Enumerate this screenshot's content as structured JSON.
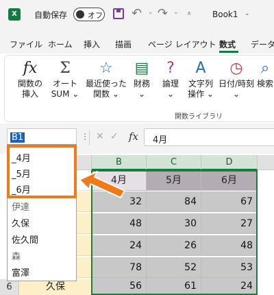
{
  "titlebar": {
    "app_icon": "X",
    "autosave_label": "自動保存",
    "autosave_state": "オフ",
    "document_title": "Book1",
    "icons": [
      "excel-icon",
      "save-icon",
      "undo-icon",
      "redo-icon",
      "customize-qat-icon"
    ]
  },
  "tabs": [
    "ファイル",
    "ホーム",
    "挿入",
    "描画",
    "ページ レイアウト",
    "数式",
    "データ"
  ],
  "active_tab": "数式",
  "ribbon": {
    "buttons": [
      {
        "icon": "fx",
        "line1": "関数の",
        "line2": "挿入"
      },
      {
        "icon": "Σ",
        "line1": "オート",
        "line2": "SUM ⌄"
      },
      {
        "icon": "☆",
        "line1": "最近使った",
        "line2": "関数 ⌄"
      },
      {
        "icon": "▤",
        "line1": "財務",
        "line2": "⌄"
      },
      {
        "icon": "?",
        "line1": "論理",
        "line2": "⌄"
      },
      {
        "icon": "A",
        "line1": "文字列",
        "line2": "操作 ⌄"
      },
      {
        "icon": "◷",
        "line1": "日付/時刻",
        "line2": "⌄"
      },
      {
        "icon": "⌕",
        "line1": "検索",
        "line2": ""
      }
    ],
    "group_label": "関数ライブラリ"
  },
  "formula_bar": {
    "name_box": "B1",
    "cancel_glyph": "✕",
    "enter_glyph": "✓",
    "fx_glyph": "fx",
    "content": "4月"
  },
  "grid": {
    "columns": [
      "B",
      "C",
      "D"
    ],
    "header_row": [
      "4月",
      "5月",
      "6月"
    ],
    "rows": [
      [
        "32",
        "84",
        "67"
      ],
      [
        "48",
        "30",
        "27"
      ],
      [
        "24",
        "26",
        "48"
      ],
      [
        "78",
        "52",
        "53"
      ],
      [
        "56",
        "61",
        "24"
      ]
    ],
    "row6": {
      "number": "6",
      "name": "久保"
    }
  },
  "name_dropdown": {
    "items": [
      "_4月",
      "_5月",
      "_6月",
      "伊達",
      "久保",
      "佐久間",
      "森",
      "富澤"
    ]
  },
  "colors": {
    "excel_green": "#107c41",
    "highlight_orange": "#f07a1a",
    "selection_border": "#1e7a3c"
  }
}
